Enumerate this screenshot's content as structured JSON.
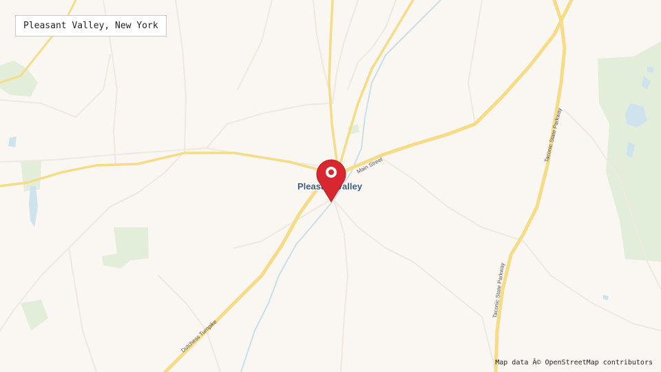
{
  "location_title": "Pleasant Valley, New York",
  "place_label": "Pleasant Valley",
  "road_labels": {
    "main_street": "Main Street",
    "dutchess_turnpike": "Dutchess Turnpike",
    "taconic_north": "Taconic State Parkway",
    "taconic_south": "Taconic State Parkway"
  },
  "attribution": "Map data Â© OpenStreetMap contributors",
  "colors": {
    "land": "#faf7f3",
    "park": "#e3eeda",
    "water": "#cfe3ee",
    "major_road": "#f6dc86",
    "minor_road": "#efe9df",
    "marker": "#d7282f"
  },
  "marker_icon": "map-pin-icon"
}
